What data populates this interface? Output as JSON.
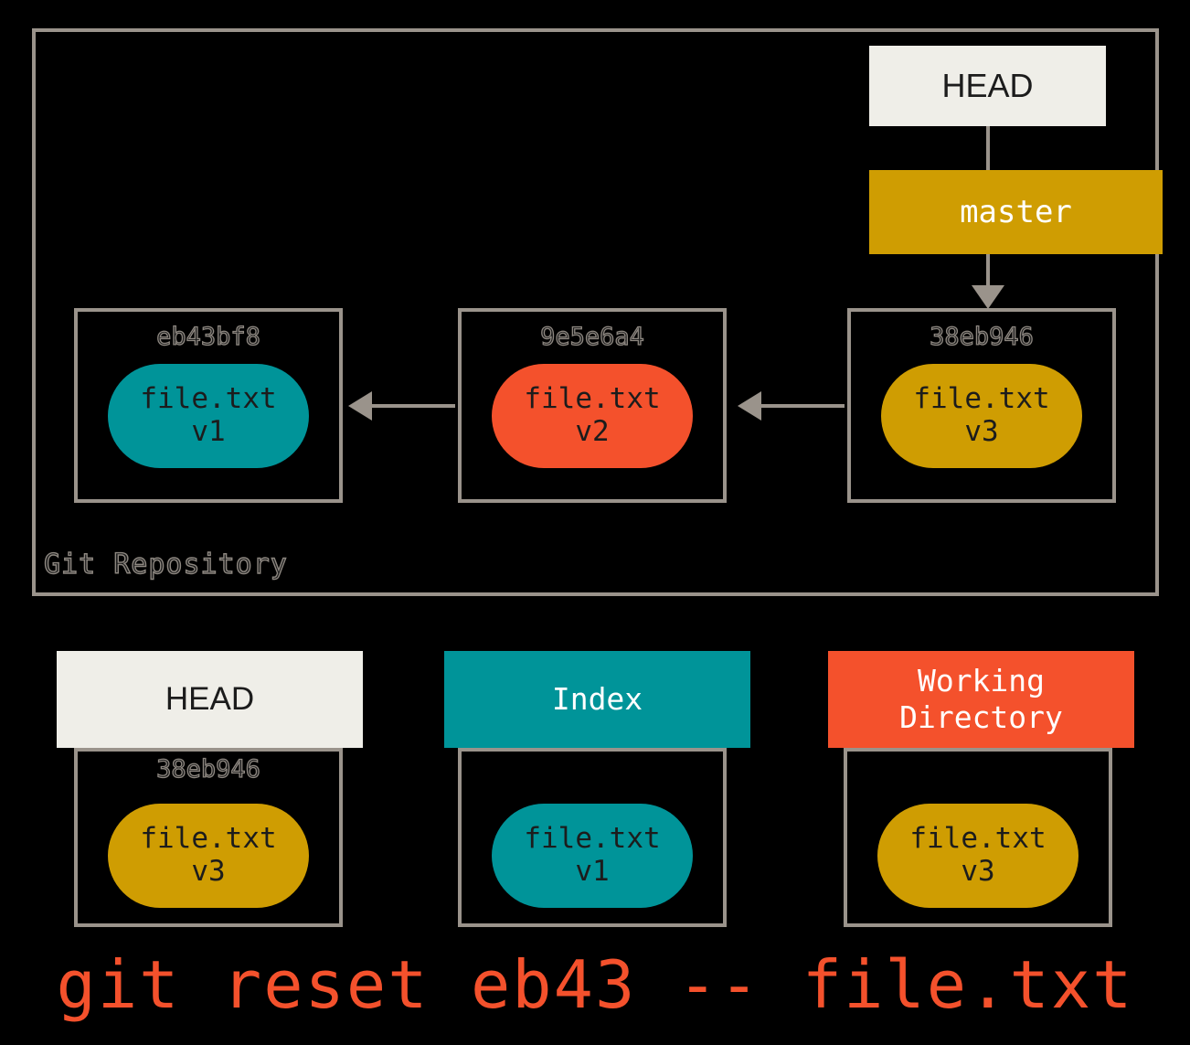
{
  "repository": {
    "label": "Git Repository",
    "head_ref": {
      "label": "HEAD",
      "box_color": "#efeee8"
    },
    "branch_ref": {
      "label": "master",
      "box_color": "#cf9d02",
      "text_color": "#ffffff"
    },
    "commits": [
      {
        "hash": "eb43bf8",
        "file_name": "file.txt",
        "version": "v1",
        "blob_color": "#009499"
      },
      {
        "hash": "9e5e6a4",
        "file_name": "file.txt",
        "version": "v2",
        "blob_color": "#f4512c"
      },
      {
        "hash": "38eb946",
        "file_name": "file.txt",
        "version": "v3",
        "blob_color": "#cf9d02"
      }
    ]
  },
  "areas": [
    {
      "title": "HEAD",
      "header_color": "#efeee8",
      "header_text_color": "#1c1c1c",
      "hash": "38eb946",
      "file_name": "file.txt",
      "version": "v3",
      "blob_color": "#cf9d02"
    },
    {
      "title": "Index",
      "header_color": "#009499",
      "header_text_color": "#ffffff",
      "hash": "",
      "file_name": "file.txt",
      "version": "v1",
      "blob_color": "#009499"
    },
    {
      "title": "Working\nDirectory",
      "title_line1": "Working",
      "title_line2": "Directory",
      "header_color": "#f4512c",
      "header_text_color": "#ffffff",
      "hash": "",
      "file_name": "file.txt",
      "version": "v3",
      "blob_color": "#cf9d02"
    }
  ],
  "command": {
    "text": "git reset eb43 -- file.txt",
    "color": "#f4512c"
  },
  "palette": {
    "background": "#000000",
    "border": "#9a938b",
    "teal": "#009499",
    "orange": "#f4512c",
    "gold": "#cf9d02",
    "cream": "#efeee8"
  }
}
